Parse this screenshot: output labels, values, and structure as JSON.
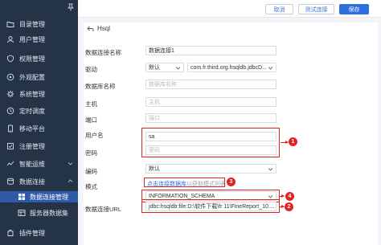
{
  "sidebar": {
    "items": [
      {
        "label": "目录管理",
        "icon": "folder-icon"
      },
      {
        "label": "用户管理",
        "icon": "user-icon"
      },
      {
        "label": "权限管理",
        "icon": "shield-icon"
      },
      {
        "label": "外观配置",
        "icon": "appearance-icon"
      },
      {
        "label": "系统管理",
        "icon": "gear-icon"
      },
      {
        "label": "定时调度",
        "icon": "clock-icon"
      },
      {
        "label": "移动平台",
        "icon": "mobile-icon"
      },
      {
        "label": "注册管理",
        "icon": "register-icon"
      },
      {
        "label": "智能运维",
        "icon": "ops-icon"
      },
      {
        "label": "数据连接",
        "icon": "database-icon"
      }
    ],
    "subitems": [
      {
        "label": "数据连接管理",
        "icon": "connection-icon",
        "active": true
      },
      {
        "label": "服务器数据集",
        "icon": "dataset-icon",
        "active": false
      }
    ],
    "bottom_item": {
      "label": "插件管理",
      "icon": "plugin-icon"
    }
  },
  "toolbar": {
    "cancel_label": "取消",
    "test_label": "测试连接",
    "save_label": "保存"
  },
  "form": {
    "back_label": "Hsql",
    "labels": {
      "name": "数据连接名称",
      "driver": "驱动",
      "db_name": "数据库名称",
      "host": "主机",
      "port": "端口",
      "username": "用户名",
      "password": "密码",
      "encoding": "编码",
      "mode": "模式",
      "url": "数据连接URL"
    },
    "values": {
      "name": "数据连接1",
      "driver_type": "默认",
      "driver_class": "com.fr.third.org.hsqldb.jdbcD...",
      "username": "sa",
      "encoding": "默认",
      "schema": "INFORMATION_SCHEMA",
      "url": "jdbc:hsqldb:file:D:\\软件下载\\fr 11\\FineReport_10...."
    },
    "placeholders": {
      "db_name": "数据库名称",
      "host": "主机",
      "port": "端口",
      "password": "密码"
    },
    "mode_link": "点击连接数据库",
    "mode_hint": "以获取模式列表"
  },
  "annotations": {
    "marker_1": "1",
    "marker_2": "2",
    "marker_3": "3",
    "marker_4": "4",
    "color": "#e02424"
  },
  "colors": {
    "sidebar_bg": "#253347",
    "active_item": "#2f5aa8",
    "primary": "#2f6fe0"
  }
}
